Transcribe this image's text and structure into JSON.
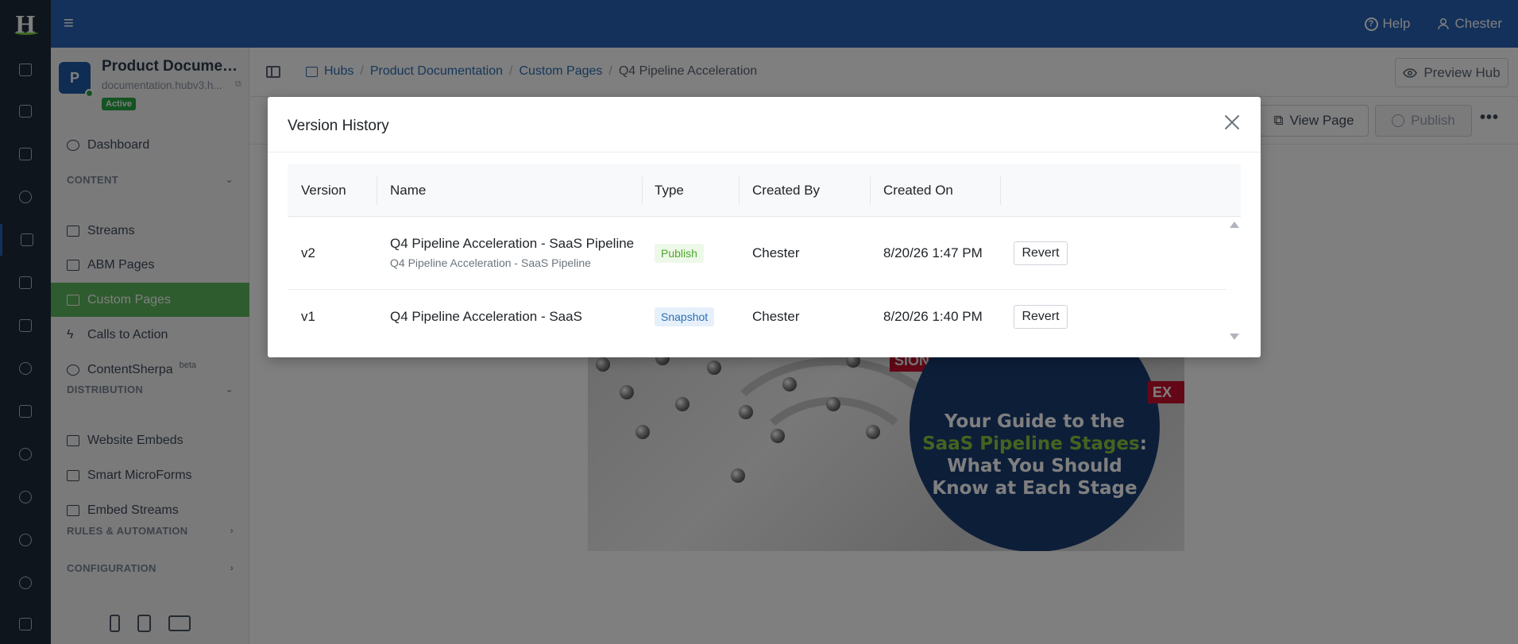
{
  "topbar": {
    "logo_letter": "H",
    "help_label": "Help",
    "user_label": "Chester"
  },
  "sidebar": {
    "hub": {
      "avatar_letter": "P",
      "title": "Product Documentation",
      "url": "documentation.hubv3.h...",
      "status": "Active"
    },
    "dashboard": "Dashboard",
    "content_section": "CONTENT",
    "content_items": [
      {
        "label": "Streams",
        "icon": "list-icon"
      },
      {
        "label": "ABM Pages",
        "icon": "building-icon"
      },
      {
        "label": "Custom Pages",
        "icon": "page-icon"
      },
      {
        "label": "Calls to Action",
        "icon": "bolt-icon"
      },
      {
        "label": "ContentSherpa",
        "icon": "brain-icon",
        "badge": "beta"
      }
    ],
    "distribution_section": "DISTRIBUTION",
    "distribution_items": [
      {
        "label": "Website Embeds",
        "icon": "window-icon"
      },
      {
        "label": "Smart MicroForms",
        "icon": "form-icon"
      },
      {
        "label": "Embed Streams",
        "icon": "share-icon"
      }
    ],
    "rules_section": "RULES & AUTOMATION",
    "config_section": "CONFIGURATION"
  },
  "breadcrumb": {
    "items": [
      "Hubs",
      "Product Documentation",
      "Custom Pages",
      "Q4 Pipeline Acceleration"
    ],
    "preview_label": "Preview Hub"
  },
  "toolbar": {
    "view_label": "View Page",
    "publish_label": "Publish",
    "more_label": "•••"
  },
  "hero": {
    "line1": "Your Guide to the",
    "line2_highlight": "SaaS Pipeline Stages",
    "line2_suffix": ":",
    "line3": "What You Should",
    "line4": "Know at Each Stage",
    "tag1": "SION",
    "tag2": "EX"
  },
  "modal": {
    "title": "Version History",
    "columns": [
      "Version",
      "Name",
      "Type",
      "Created By",
      "Created On"
    ],
    "rows": [
      {
        "version": "v2",
        "name": "Q4 Pipeline Acceleration - SaaS Pipeline",
        "subname": "Q4 Pipeline Acceleration - SaaS Pipeline",
        "type": "Publish",
        "created_by": "Chester",
        "created_on": "8/20/26 1:47 PM",
        "action": "Revert"
      },
      {
        "version": "v1",
        "name": "Q4 Pipeline Acceleration - SaaS",
        "subname": "",
        "type": "Snapshot",
        "created_by": "Chester",
        "created_on": "8/20/26 1:40 PM",
        "action": "Revert"
      }
    ]
  },
  "colors": {
    "topbar": "#2762b5",
    "rail": "#1e2a38",
    "active_nav": "#5cb85c",
    "publish_tag": "#4ca92e",
    "snapshot_tag": "#2c6fb3"
  }
}
